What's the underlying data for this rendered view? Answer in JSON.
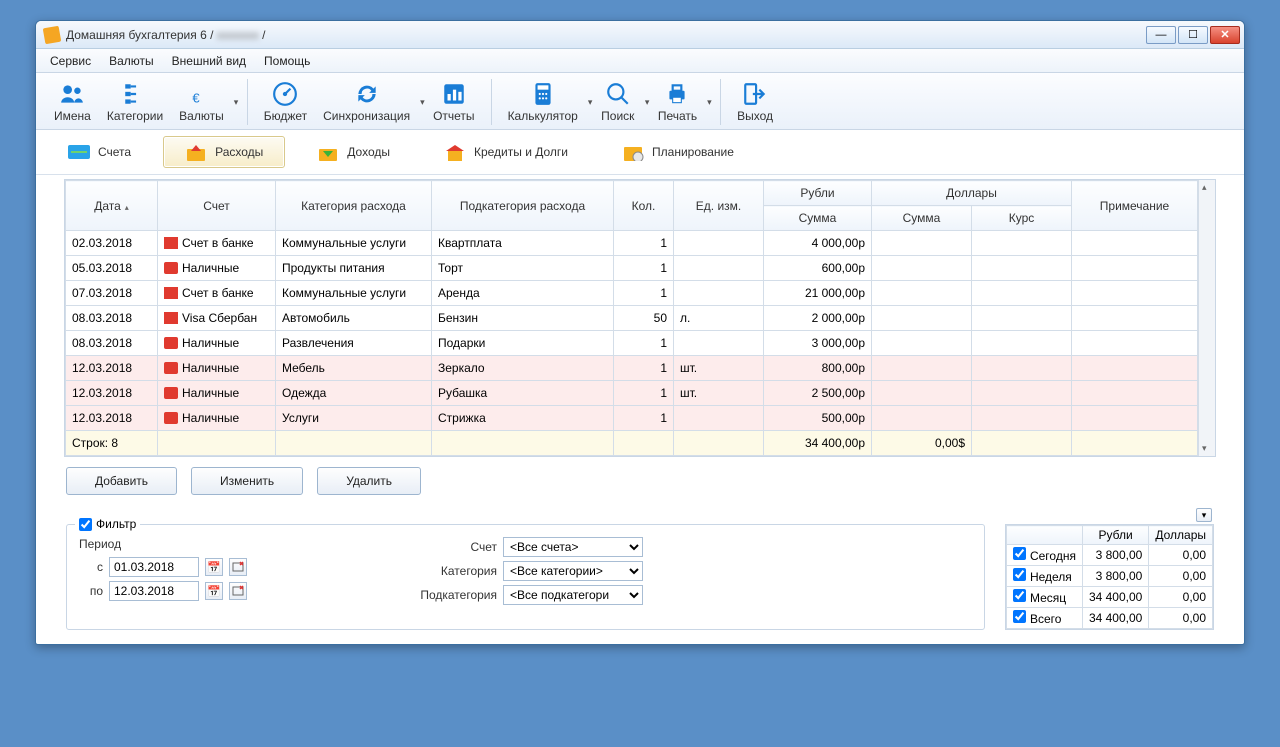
{
  "title": {
    "app": "Домашняя бухгалтерия 6",
    "sep1": " / ",
    "user": "xxxxxxx",
    "sep2": " /"
  },
  "menu": {
    "service": "Сервис",
    "currencies": "Валюты",
    "view": "Внешний вид",
    "help": "Помощь"
  },
  "toolbar": {
    "names": "Имена",
    "categories": "Категории",
    "currencies": "Валюты",
    "budget": "Бюджет",
    "sync": "Синхронизация",
    "reports": "Отчеты",
    "calc": "Калькулятор",
    "search": "Поиск",
    "print": "Печать",
    "exit": "Выход"
  },
  "tabs": {
    "accounts": "Счета",
    "expenses": "Расходы",
    "income": "Доходы",
    "credits": "Кредиты и Долги",
    "planning": "Планирование"
  },
  "grid": {
    "headers": {
      "date": "Дата",
      "account": "Счет",
      "category": "Категория расхода",
      "subcategory": "Подкатегория расхода",
      "qty": "Кол.",
      "unit": "Ед. изм.",
      "rub": "Рубли",
      "usd": "Доллары",
      "sum": "Сумма",
      "rate": "Курс",
      "note": "Примечание"
    },
    "rows": [
      {
        "date": "02.03.2018",
        "acct": "Счет в банке",
        "acct_ic": "bank",
        "cat": "Коммунальные услуги",
        "sub": "Квартплата",
        "qty": "1",
        "unit": "",
        "rub": "4 000,00р",
        "usd": "",
        "rate": "",
        "note": "",
        "cls": ""
      },
      {
        "date": "05.03.2018",
        "acct": "Наличные",
        "acct_ic": "cash",
        "cat": "Продукты питания",
        "sub": "Торт",
        "qty": "1",
        "unit": "",
        "rub": "600,00р",
        "usd": "",
        "rate": "",
        "note": "",
        "cls": ""
      },
      {
        "date": "07.03.2018",
        "acct": "Счет в банке",
        "acct_ic": "bank",
        "cat": "Коммунальные услуги",
        "sub": "Аренда",
        "qty": "1",
        "unit": "",
        "rub": "21 000,00р",
        "usd": "",
        "rate": "",
        "note": "",
        "cls": ""
      },
      {
        "date": "08.03.2018",
        "acct": "Visa Сбербан",
        "acct_ic": "card",
        "cat": "Автомобиль",
        "sub": "Бензин",
        "qty": "50",
        "unit": "л.",
        "rub": "2 000,00р",
        "usd": "",
        "rate": "",
        "note": "",
        "cls": ""
      },
      {
        "date": "08.03.2018",
        "acct": "Наличные",
        "acct_ic": "cash",
        "cat": "Развлечения",
        "sub": "Подарки",
        "qty": "1",
        "unit": "",
        "rub": "3 000,00р",
        "usd": "",
        "rate": "",
        "note": "",
        "cls": ""
      },
      {
        "date": "12.03.2018",
        "acct": "Наличные",
        "acct_ic": "cash",
        "cat": "Мебель",
        "sub": "Зеркало",
        "qty": "1",
        "unit": "шт.",
        "rub": "800,00р",
        "usd": "",
        "rate": "",
        "note": "",
        "cls": "row-pink"
      },
      {
        "date": "12.03.2018",
        "acct": "Наличные",
        "acct_ic": "cash",
        "cat": "Одежда",
        "sub": "Рубашка",
        "qty": "1",
        "unit": "шт.",
        "rub": "2 500,00р",
        "usd": "",
        "rate": "",
        "note": "",
        "cls": "row-pink"
      },
      {
        "date": "12.03.2018",
        "acct": "Наличные",
        "acct_ic": "cash",
        "cat": "Услуги",
        "sub": "Стрижка",
        "qty": "1",
        "unit": "",
        "rub": "500,00р",
        "usd": "",
        "rate": "",
        "note": "",
        "cls": "row-pink"
      }
    ],
    "footer": {
      "rows": "Строк: 8",
      "rub": "34 400,00р",
      "usd": "0,00$"
    }
  },
  "buttons": {
    "add": "Добавить",
    "edit": "Изменить",
    "del": "Удалить"
  },
  "filter": {
    "label": "Фильтр",
    "period": "Период",
    "from": "с",
    "to": "по",
    "from_val": "01.03.2018",
    "to_val": "12.03.2018",
    "account": "Счет",
    "account_val": "<Все счета>",
    "category": "Категория",
    "category_val": "<Все категории>",
    "subcategory": "Подкатегория",
    "subcategory_val": "<Все подкатегори"
  },
  "summary": {
    "rub": "Рубли",
    "usd": "Доллары",
    "rows": [
      {
        "k": "Сегодня",
        "r": "3 800,00",
        "u": "0,00"
      },
      {
        "k": "Неделя",
        "r": "3 800,00",
        "u": "0,00"
      },
      {
        "k": "Месяц",
        "r": "34 400,00",
        "u": "0,00"
      },
      {
        "k": "Всего",
        "r": "34 400,00",
        "u": "0,00"
      }
    ]
  }
}
